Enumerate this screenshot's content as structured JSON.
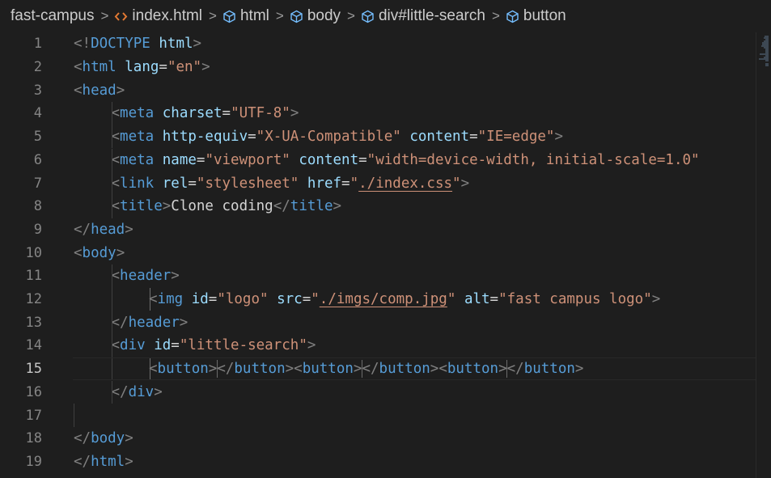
{
  "breadcrumb": {
    "folder": "fast-campus",
    "file": "index.html",
    "items": [
      "html",
      "body",
      "div#little-search",
      "button"
    ],
    "folder_icon": "chevron-right-icon",
    "file_icon": "html-file-icon",
    "symbol_icon": "symbol-element-icon"
  },
  "editor": {
    "current_line": 15,
    "lines": [
      {
        "n": "1",
        "tokens": [
          [
            "b",
            "<!"
          ],
          [
            "t",
            "DOCTYPE"
          ],
          [
            "txt",
            " "
          ],
          [
            "a",
            "html"
          ],
          [
            "b",
            ">"
          ]
        ]
      },
      {
        "n": "2",
        "tokens": [
          [
            "b",
            "<"
          ],
          [
            "t",
            "html"
          ],
          [
            "txt",
            " "
          ],
          [
            "a",
            "lang"
          ],
          [
            "txt",
            "="
          ],
          [
            "s",
            "\"en\""
          ],
          [
            "b",
            ">"
          ]
        ]
      },
      {
        "n": "3",
        "tokens": [
          [
            "b",
            "<"
          ],
          [
            "t",
            "head"
          ],
          [
            "b",
            ">"
          ]
        ]
      },
      {
        "n": "4",
        "indent": 1,
        "tokens": [
          [
            "b",
            "<"
          ],
          [
            "t",
            "meta"
          ],
          [
            "txt",
            " "
          ],
          [
            "a",
            "charset"
          ],
          [
            "txt",
            "="
          ],
          [
            "s",
            "\"UTF-8\""
          ],
          [
            "b",
            ">"
          ]
        ]
      },
      {
        "n": "5",
        "indent": 1,
        "tokens": [
          [
            "b",
            "<"
          ],
          [
            "t",
            "meta"
          ],
          [
            "txt",
            " "
          ],
          [
            "a",
            "http-equiv"
          ],
          [
            "txt",
            "="
          ],
          [
            "s",
            "\"X-UA-Compatible\""
          ],
          [
            "txt",
            " "
          ],
          [
            "a",
            "content"
          ],
          [
            "txt",
            "="
          ],
          [
            "s",
            "\"IE=edge\""
          ],
          [
            "b",
            ">"
          ]
        ]
      },
      {
        "n": "6",
        "indent": 1,
        "tokens": [
          [
            "b",
            "<"
          ],
          [
            "t",
            "meta"
          ],
          [
            "txt",
            " "
          ],
          [
            "a",
            "name"
          ],
          [
            "txt",
            "="
          ],
          [
            "s",
            "\"viewport\""
          ],
          [
            "txt",
            " "
          ],
          [
            "a",
            "content"
          ],
          [
            "txt",
            "="
          ],
          [
            "s",
            "\"width=device-width, initial-scale=1.0\""
          ]
        ]
      },
      {
        "n": "7",
        "indent": 1,
        "tokens": [
          [
            "b",
            "<"
          ],
          [
            "t",
            "link"
          ],
          [
            "txt",
            " "
          ],
          [
            "a",
            "rel"
          ],
          [
            "txt",
            "="
          ],
          [
            "s",
            "\"stylesheet\""
          ],
          [
            "txt",
            " "
          ],
          [
            "a",
            "href"
          ],
          [
            "txt",
            "="
          ],
          [
            "s",
            "\""
          ],
          [
            "sl",
            "./index.css"
          ],
          [
            "s",
            "\""
          ],
          [
            "b",
            ">"
          ]
        ]
      },
      {
        "n": "8",
        "indent": 1,
        "tokens": [
          [
            "b",
            "<"
          ],
          [
            "t",
            "title"
          ],
          [
            "b",
            ">"
          ],
          [
            "txt",
            "Clone coding"
          ],
          [
            "b",
            "</"
          ],
          [
            "t",
            "title"
          ],
          [
            "b",
            ">"
          ]
        ]
      },
      {
        "n": "9",
        "tokens": [
          [
            "b",
            "</"
          ],
          [
            "t",
            "head"
          ],
          [
            "b",
            ">"
          ]
        ]
      },
      {
        "n": "10",
        "tokens": [
          [
            "b",
            "<"
          ],
          [
            "t",
            "body"
          ],
          [
            "b",
            ">"
          ]
        ]
      },
      {
        "n": "11",
        "indent": 1,
        "tokens": [
          [
            "b",
            "<"
          ],
          [
            "t",
            "header"
          ],
          [
            "b",
            ">"
          ]
        ]
      },
      {
        "n": "12",
        "indent": 2,
        "tokens": [
          [
            "b",
            "<"
          ],
          [
            "t",
            "img"
          ],
          [
            "txt",
            " "
          ],
          [
            "a",
            "id"
          ],
          [
            "txt",
            "="
          ],
          [
            "s",
            "\"logo\""
          ],
          [
            "txt",
            " "
          ],
          [
            "a",
            "src"
          ],
          [
            "txt",
            "="
          ],
          [
            "s",
            "\""
          ],
          [
            "sl",
            "./imgs/comp.jpg"
          ],
          [
            "s",
            "\""
          ],
          [
            "txt",
            " "
          ],
          [
            "a",
            "alt"
          ],
          [
            "txt",
            "="
          ],
          [
            "s",
            "\"fast campus logo\""
          ],
          [
            "b",
            ">"
          ]
        ]
      },
      {
        "n": "13",
        "indent": 1,
        "tokens": [
          [
            "b",
            "</"
          ],
          [
            "t",
            "header"
          ],
          [
            "b",
            ">"
          ]
        ]
      },
      {
        "n": "14",
        "indent": 1,
        "tokens": [
          [
            "b",
            "<"
          ],
          [
            "t",
            "div"
          ],
          [
            "txt",
            " "
          ],
          [
            "a",
            "id"
          ],
          [
            "txt",
            "="
          ],
          [
            "s",
            "\"little-search\""
          ],
          [
            "b",
            ">"
          ]
        ]
      },
      {
        "n": "15",
        "indent": 2,
        "tokens": [
          [
            "b",
            "<"
          ],
          [
            "t",
            "button"
          ],
          [
            "b",
            ">"
          ],
          [
            "c",
            ""
          ],
          [
            "b",
            "</"
          ],
          [
            "t",
            "button"
          ],
          [
            "b",
            ">"
          ],
          [
            "b",
            "<"
          ],
          [
            "t",
            "button"
          ],
          [
            "b",
            ">"
          ],
          [
            "c",
            ""
          ],
          [
            "b",
            "</"
          ],
          [
            "t",
            "button"
          ],
          [
            "b",
            ">"
          ],
          [
            "b",
            "<"
          ],
          [
            "t",
            "button"
          ],
          [
            "b",
            ">"
          ],
          [
            "c",
            ""
          ],
          [
            "b",
            "</"
          ],
          [
            "t",
            "button"
          ],
          [
            "b",
            ">"
          ]
        ]
      },
      {
        "n": "16",
        "indent": 1,
        "tokens": [
          [
            "b",
            "</"
          ],
          [
            "t",
            "div"
          ],
          [
            "b",
            ">"
          ]
        ]
      },
      {
        "n": "17",
        "tokens": []
      },
      {
        "n": "18",
        "tokens": [
          [
            "b",
            "</"
          ],
          [
            "t",
            "body"
          ],
          [
            "b",
            ">"
          ]
        ]
      },
      {
        "n": "19",
        "tokens": [
          [
            "b",
            "</"
          ],
          [
            "t",
            "html"
          ],
          [
            "b",
            ">"
          ]
        ]
      }
    ]
  }
}
